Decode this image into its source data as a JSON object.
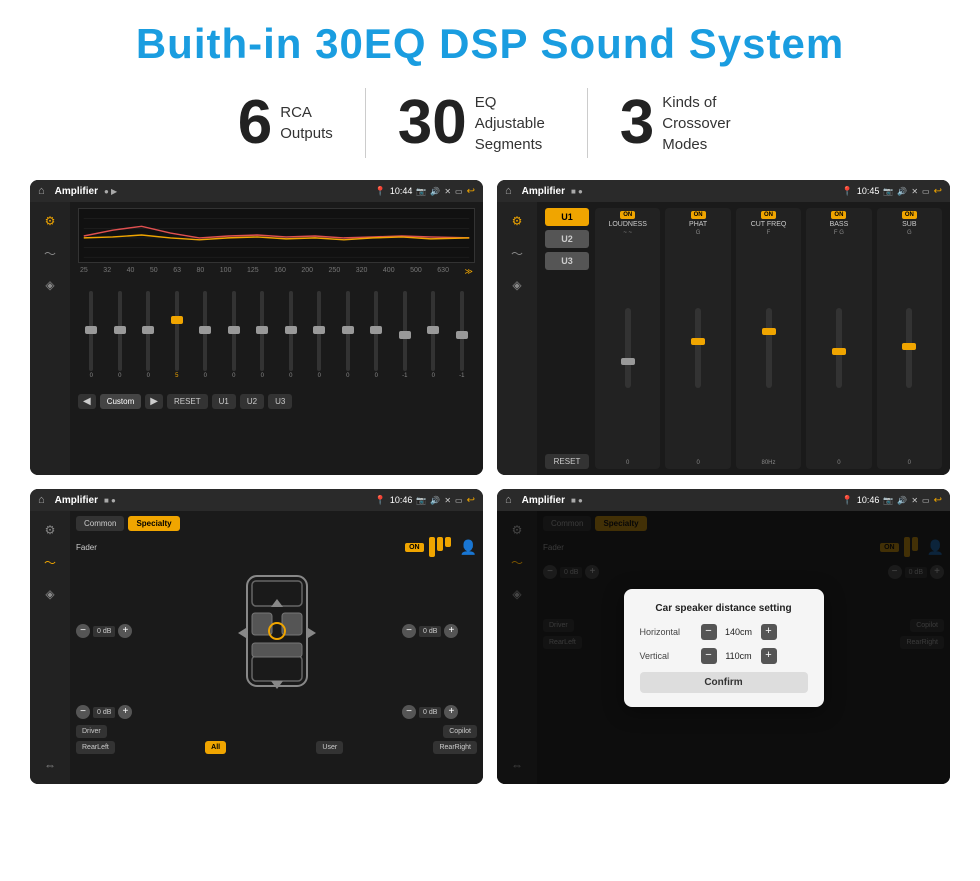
{
  "page": {
    "title": "Buith-in 30EQ DSP Sound System"
  },
  "features": [
    {
      "number": "6",
      "desc_line1": "RCA",
      "desc_line2": "Outputs"
    },
    {
      "number": "30",
      "desc_line1": "EQ Adjustable",
      "desc_line2": "Segments"
    },
    {
      "number": "3",
      "desc_line1": "Kinds of",
      "desc_line2": "Crossover Modes"
    }
  ],
  "screens": [
    {
      "id": "eq-screen",
      "topbar": {
        "time": "10:44",
        "title": "Amplifier"
      },
      "type": "eq"
    },
    {
      "id": "crossover-screen",
      "topbar": {
        "time": "10:45",
        "title": "Amplifier"
      },
      "type": "crossover"
    },
    {
      "id": "specialty-screen",
      "topbar": {
        "time": "10:46",
        "title": "Amplifier"
      },
      "type": "specialty"
    },
    {
      "id": "dialog-screen",
      "topbar": {
        "time": "10:46",
        "title": "Amplifier"
      },
      "type": "dialog"
    }
  ],
  "eq": {
    "bands": [
      "25",
      "32",
      "40",
      "50",
      "63",
      "80",
      "100",
      "125",
      "160",
      "200",
      "250",
      "320",
      "400",
      "500",
      "630"
    ],
    "values": [
      "0",
      "0",
      "0",
      "5",
      "0",
      "0",
      "0",
      "0",
      "0",
      "0",
      "0",
      "-1",
      "0",
      "-1"
    ],
    "preset": "Custom",
    "buttons": [
      "RESET",
      "U1",
      "U2",
      "U3"
    ]
  },
  "crossover": {
    "units": [
      "U1",
      "U2",
      "U3"
    ],
    "sections": [
      "LOUDNESS",
      "PHAT",
      "CUT FREQ",
      "BASS",
      "SUB"
    ],
    "reset": "RESET"
  },
  "specialty": {
    "tabs": [
      "Common",
      "Specialty"
    ],
    "fader_label": "Fader",
    "fader_on": "ON",
    "zones": [
      {
        "label": "0 dB"
      },
      {
        "label": "0 dB"
      },
      {
        "label": "0 dB"
      },
      {
        "label": "0 dB"
      }
    ],
    "bottom_labels": [
      "Driver",
      "",
      "Copilot",
      "RearLeft",
      "All",
      "",
      "User",
      "RearRight"
    ]
  },
  "dialog": {
    "title": "Car speaker distance setting",
    "horizontal_label": "Horizontal",
    "horizontal_value": "140cm",
    "vertical_label": "Vertical",
    "vertical_value": "110cm",
    "confirm_label": "Confirm",
    "zones": [
      {
        "label": "0 dB"
      },
      {
        "label": "0 dB"
      }
    ]
  }
}
